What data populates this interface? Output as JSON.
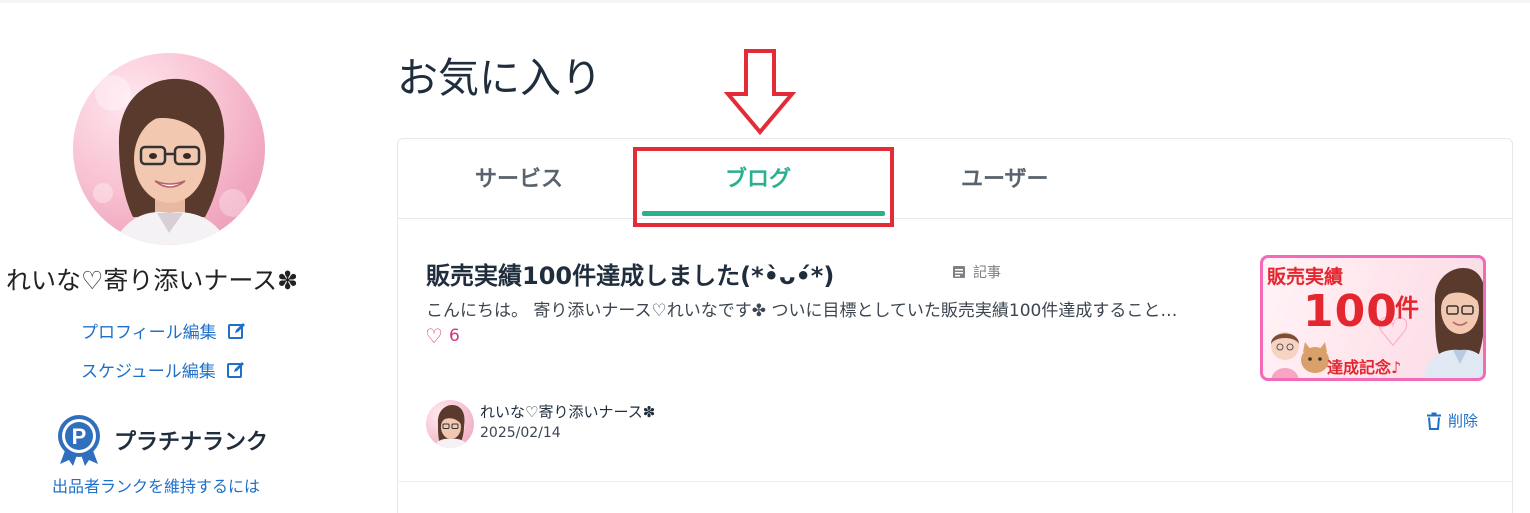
{
  "sidebar": {
    "profile_name": "れいな♡寄り添いナース✽",
    "links": [
      {
        "label": "プロフィール編集",
        "icon": "edit-icon"
      },
      {
        "label": "スケジュール編集",
        "icon": "edit-icon"
      }
    ],
    "rank": {
      "badge_letter": "P",
      "title": "プラチナランク",
      "link": "出品者ランクを維持するには"
    }
  },
  "main": {
    "title": "お気に入り",
    "tabs": [
      {
        "label": "サービス",
        "active": false
      },
      {
        "label": "ブログ",
        "active": true
      },
      {
        "label": "ユーザー",
        "active": false
      }
    ],
    "posts": [
      {
        "title": "販売実績100件達成しました(*•̀ᴗ•́*)",
        "type_label": "記事",
        "excerpt": "こんにちは。 寄り添いナース♡れいなです✤ ついに目標としていた販売実績100件達成すること…",
        "likes": "6",
        "thumbnail": {
          "title": "販売実績",
          "number": "100",
          "unit": "件",
          "subtitle": "達成記念♪"
        },
        "author": "れいな♡寄り添いナース✽",
        "date": "2025/02/14",
        "delete_label": "削除"
      }
    ]
  },
  "colors": {
    "accent": "#2ab08f",
    "link": "#1f70c8",
    "highlight": "#e22d38",
    "like": "#d5357a",
    "thumb_border": "#f36ab8"
  }
}
